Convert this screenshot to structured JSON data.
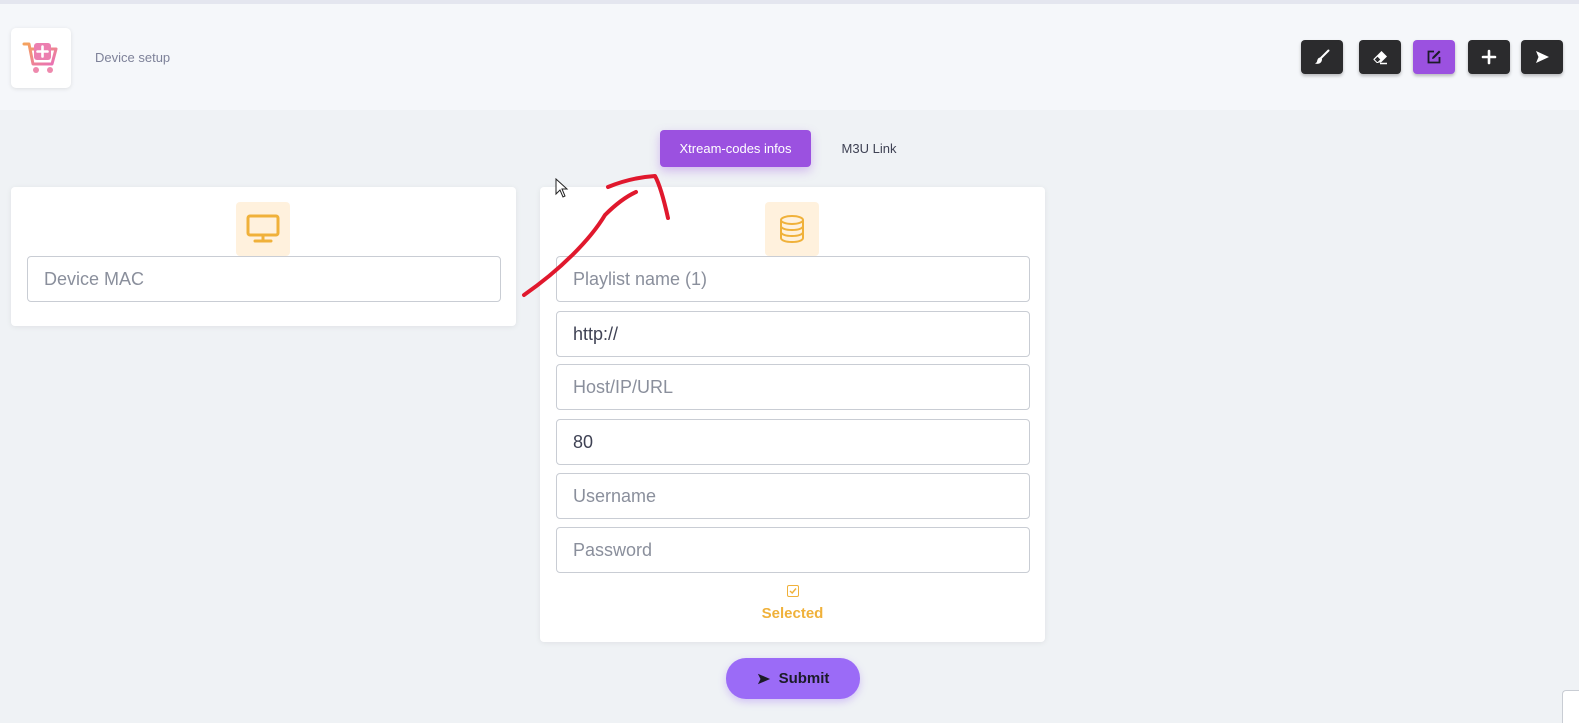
{
  "header": {
    "page_title": "Device setup",
    "logo_icon": "cart-plus-icon"
  },
  "toolbar": {
    "buttons": [
      {
        "icon": "brush-icon",
        "active": false
      },
      {
        "icon": "eraser-icon",
        "active": false
      },
      {
        "icon": "edit-icon",
        "active": true
      },
      {
        "icon": "plus-icon",
        "active": false
      },
      {
        "icon": "send-icon",
        "active": false
      }
    ]
  },
  "tabs": {
    "xtream_label": "Xtream-codes infos",
    "m3u_label": "M3U Link",
    "active": "xtream"
  },
  "device_card": {
    "icon": "monitor-icon",
    "mac_placeholder": "Device MAC",
    "mac_value": ""
  },
  "playlist_card": {
    "icon": "database-icon",
    "playlist_name_placeholder": "Playlist name (1)",
    "protocol_value": "http://",
    "host_placeholder": "Host/IP/URL",
    "port_value": "80",
    "username_placeholder": "Username",
    "password_placeholder": "Password",
    "selected_label": "Selected",
    "selected": true
  },
  "submit": {
    "label": "Submit",
    "icon": "send-icon"
  },
  "colors": {
    "accent": "#9b51e0",
    "submit": "#9b6bf7",
    "highlight": "#f0b13a",
    "annotation": "#e0182d"
  }
}
